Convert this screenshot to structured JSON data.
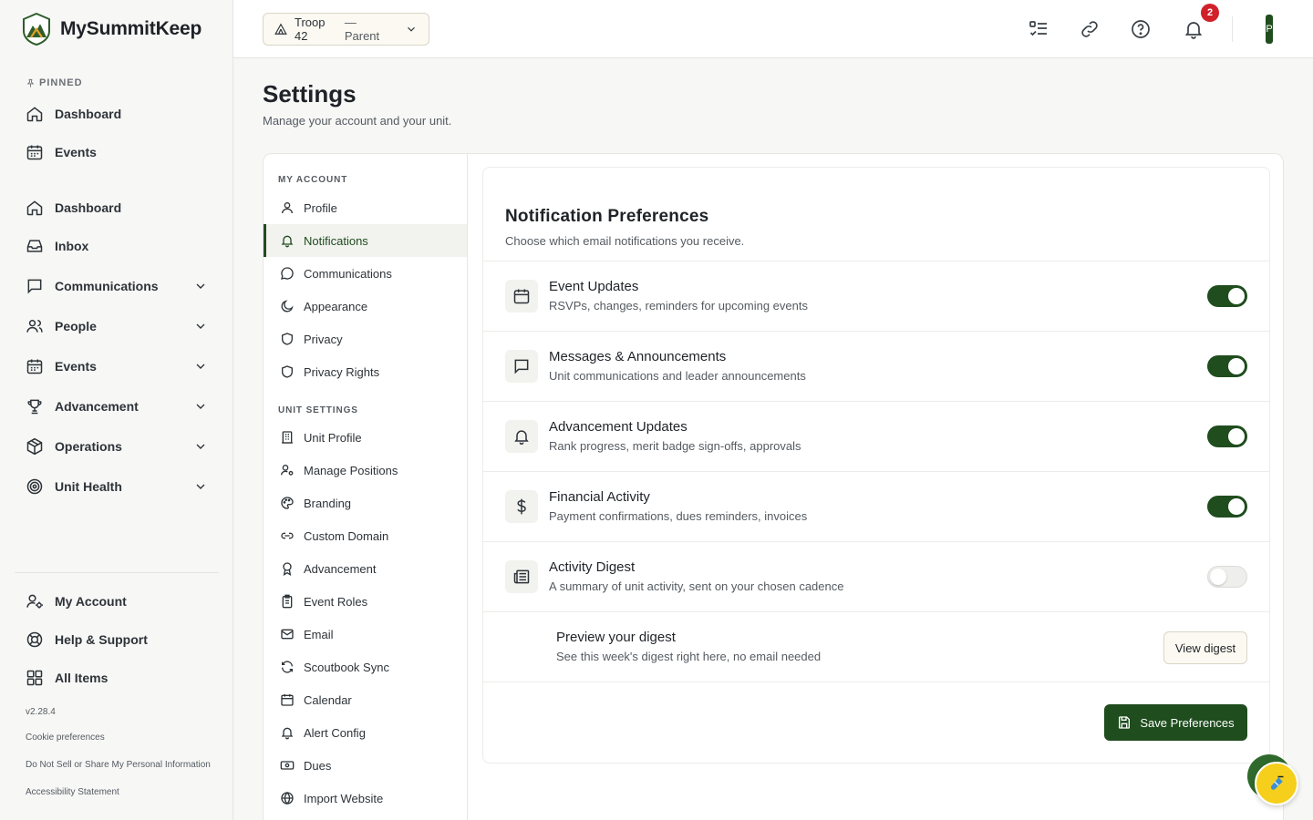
{
  "app": {
    "name": "MySummitKeep",
    "version": "v2.28.4"
  },
  "sidebar": {
    "pinned_label": "PINNED",
    "pinned": [
      {
        "label": "Dashboard",
        "icon": "home-icon"
      },
      {
        "label": "Events",
        "icon": "calendar-icon"
      }
    ],
    "main": [
      {
        "label": "Dashboard",
        "icon": "home-icon"
      },
      {
        "label": "Inbox",
        "icon": "inbox-icon"
      },
      {
        "label": "Communications",
        "icon": "message-icon",
        "expandable": true
      },
      {
        "label": "People",
        "icon": "users-icon",
        "expandable": true
      },
      {
        "label": "Events",
        "icon": "calendar-icon",
        "expandable": true
      },
      {
        "label": "Advancement",
        "icon": "trophy-icon",
        "expandable": true
      },
      {
        "label": "Operations",
        "icon": "box-icon",
        "expandable": true
      },
      {
        "label": "Unit Health",
        "icon": "target-icon",
        "expandable": true
      }
    ],
    "bottom": [
      {
        "label": "My Account",
        "icon": "user-gear-icon"
      },
      {
        "label": "Help & Support",
        "icon": "lifebuoy-icon"
      },
      {
        "label": "All Items",
        "icon": "grid-icon"
      }
    ],
    "footer_links": [
      "Cookie preferences",
      "Do Not Sell or Share My Personal Information",
      "Accessibility Statement"
    ]
  },
  "topbar": {
    "unit_name": "Troop 42",
    "unit_role": "— Parent",
    "notification_count": "2",
    "avatar_initial": "P"
  },
  "page": {
    "title": "Settings",
    "subtitle": "Manage your account and your unit."
  },
  "settings_nav": {
    "my_account_label": "MY ACCOUNT",
    "my_account": [
      {
        "label": "Profile",
        "icon": "user-icon"
      },
      {
        "label": "Notifications",
        "icon": "bell-icon",
        "active": true
      },
      {
        "label": "Communications",
        "icon": "chat-icon"
      },
      {
        "label": "Appearance",
        "icon": "moon-icon"
      },
      {
        "label": "Privacy",
        "icon": "shield-icon"
      },
      {
        "label": "Privacy Rights",
        "icon": "shield-icon"
      }
    ],
    "unit_settings_label": "UNIT SETTINGS",
    "unit_settings": [
      {
        "label": "Unit Profile",
        "icon": "building-icon"
      },
      {
        "label": "Manage Positions",
        "icon": "user-gear-icon"
      },
      {
        "label": "Branding",
        "icon": "palette-icon"
      },
      {
        "label": "Custom Domain",
        "icon": "link-icon"
      },
      {
        "label": "Advancement",
        "icon": "award-icon"
      },
      {
        "label": "Event Roles",
        "icon": "clipboard-icon"
      },
      {
        "label": "Email",
        "icon": "mail-icon"
      },
      {
        "label": "Scoutbook Sync",
        "icon": "refresh-icon"
      },
      {
        "label": "Calendar",
        "icon": "calendar-icon"
      },
      {
        "label": "Alert Config",
        "icon": "bell-icon"
      },
      {
        "label": "Dues",
        "icon": "cash-icon"
      },
      {
        "label": "Import Website",
        "icon": "globe-icon"
      }
    ]
  },
  "notifications": {
    "title": "Notification Preferences",
    "subtitle": "Choose which email notifications you receive.",
    "items": [
      {
        "title": "Event Updates",
        "description": "RSVPs, changes, reminders for upcoming events",
        "icon": "calendar-icon",
        "enabled": true
      },
      {
        "title": "Messages & Announcements",
        "description": "Unit communications and leader announcements",
        "icon": "message-icon",
        "enabled": true
      },
      {
        "title": "Advancement Updates",
        "description": "Rank progress, merit badge sign-offs, approvals",
        "icon": "bell-icon",
        "enabled": true
      },
      {
        "title": "Financial Activity",
        "description": "Payment confirmations, dues reminders, invoices",
        "icon": "dollar-icon",
        "enabled": true
      },
      {
        "title": "Activity Digest",
        "description": "A summary of unit activity, sent on your chosen cadence",
        "icon": "newspaper-icon",
        "enabled": false
      }
    ],
    "preview": {
      "title": "Preview your digest",
      "description": "See this week's digest right here, no email needed",
      "button": "View digest"
    },
    "save_button": "Save Preferences"
  },
  "colors": {
    "accent": "#1f4d1e",
    "badge": "#d0202a",
    "fab": "#f5cf1c"
  }
}
